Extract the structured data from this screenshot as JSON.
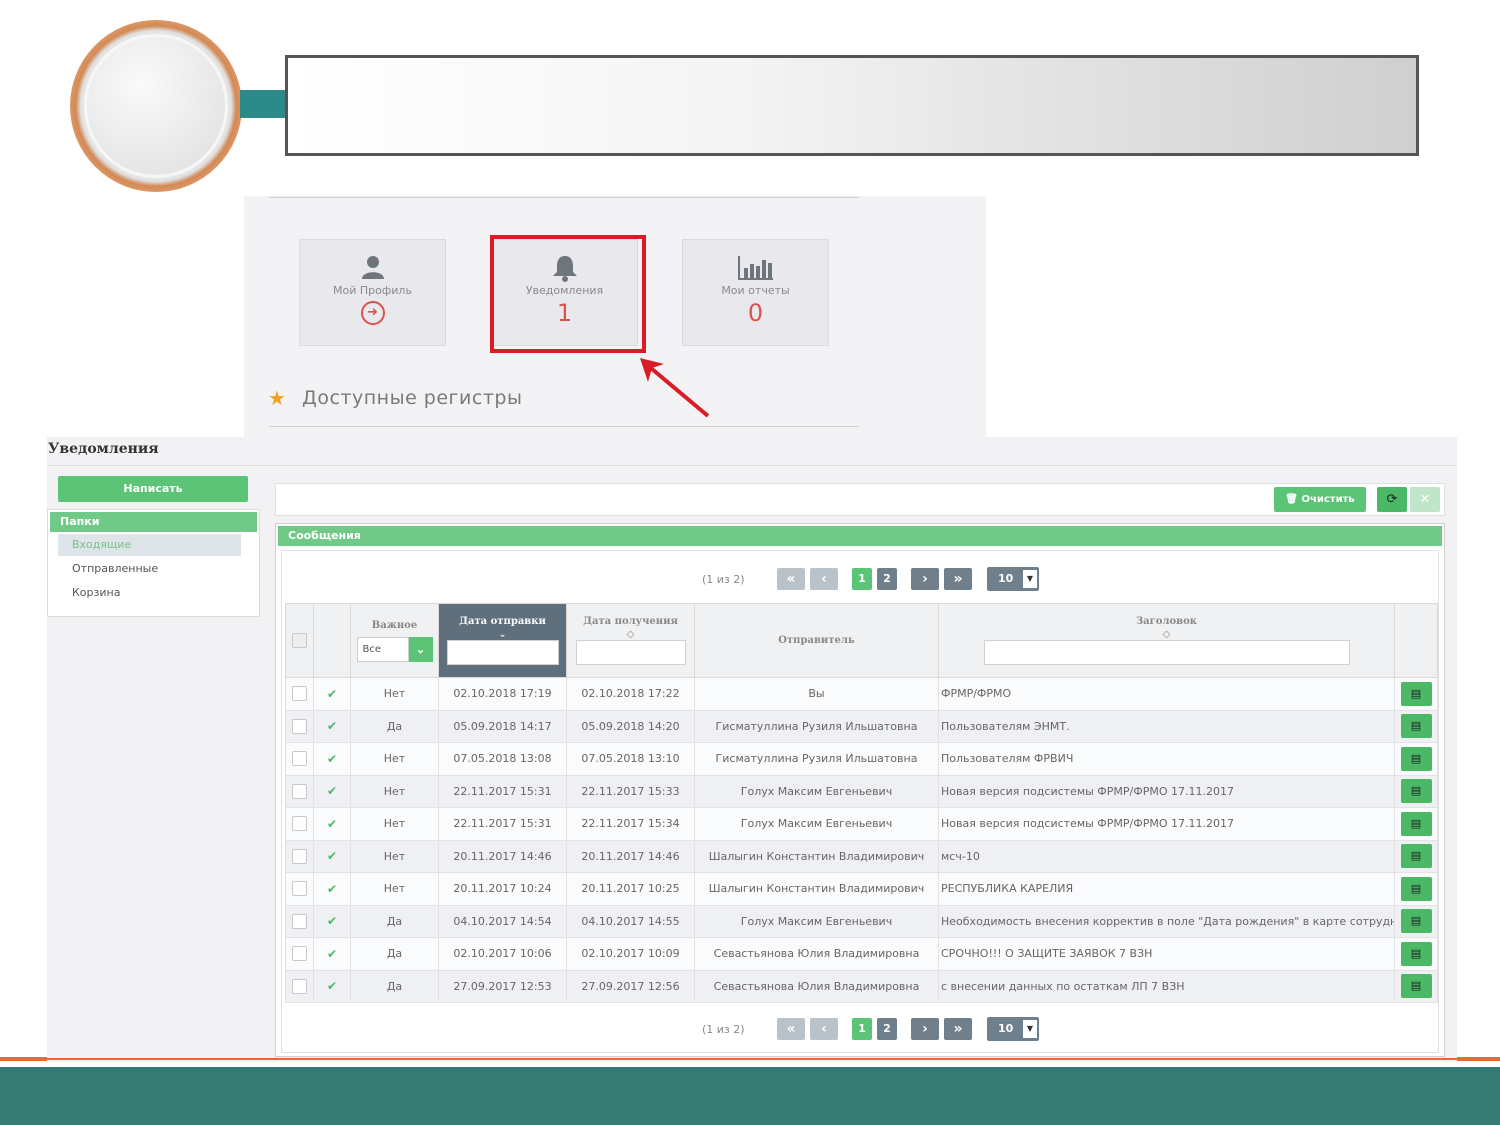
{
  "colors": {
    "accent": "#5cc477",
    "highlight": "#d91c26",
    "footer": "#367a74",
    "header_bar": "#2d8a8a",
    "sorted_header": "#5f6f7c"
  },
  "tiles": [
    {
      "label": "Мой Профиль",
      "icon": "user-icon",
      "value": ""
    },
    {
      "label": "Уведомления",
      "icon": "bell-icon",
      "value": "1"
    },
    {
      "label": "Мои отчеты",
      "icon": "bar-chart-icon",
      "value": "0"
    }
  ],
  "registers_title": "Доступные регистры",
  "app": {
    "page_title": "Уведомления",
    "write_button": "Написать",
    "folders": {
      "header": "Папки",
      "items": [
        "Входящие",
        "Отправленные",
        "Корзина"
      ],
      "active": "Входящие"
    },
    "toolbar": {
      "clear_label": "Очистить",
      "refresh_icon": "refresh-icon",
      "close_icon": "close-icon"
    },
    "messages_header": "Сообщения",
    "pager": {
      "info": "(1 из 2)",
      "pages": [
        "1",
        "2"
      ],
      "current": "1",
      "page_size": "10"
    },
    "columns": {
      "important": "Важное",
      "important_filter": "Все",
      "sent": "Дата отправки",
      "received": "Дата получения",
      "sender": "Отправитель",
      "title": "Заголовок"
    },
    "rows": [
      {
        "important": "Нет",
        "sent": "02.10.2018 17:19",
        "received": "02.10.2018 17:22",
        "sender": "Вы",
        "title": "ФРМР/ФРМО"
      },
      {
        "important": "Да",
        "sent": "05.09.2018 14:17",
        "received": "05.09.2018 14:20",
        "sender": "Гисматуллина Рузиля Ильшатовна",
        "title": "Пользователям ЭНМТ."
      },
      {
        "important": "Нет",
        "sent": "07.05.2018 13:08",
        "received": "07.05.2018 13:10",
        "sender": "Гисматуллина Рузиля Ильшатовна",
        "title": "Пользователям ФРВИЧ"
      },
      {
        "important": "Нет",
        "sent": "22.11.2017 15:31",
        "received": "22.11.2017 15:33",
        "sender": "Голух Максим Евгеньевич",
        "title": "Новая версия подсистемы ФРМР/ФРМО 17.11.2017"
      },
      {
        "important": "Нет",
        "sent": "22.11.2017 15:31",
        "received": "22.11.2017 15:34",
        "sender": "Голух Максим Евгеньевич",
        "title": "Новая версия подсистемы ФРМР/ФРМО 17.11.2017"
      },
      {
        "important": "Нет",
        "sent": "20.11.2017 14:46",
        "received": "20.11.2017 14:46",
        "sender": "Шалыгин Константин Владимирович",
        "title": "мсч-10"
      },
      {
        "important": "Нет",
        "sent": "20.11.2017 10:24",
        "received": "20.11.2017 10:25",
        "sender": "Шалыгин Константин Владимирович",
        "title": "РЕСПУБЛИКА КАРЕЛИЯ"
      },
      {
        "important": "Да",
        "sent": "04.10.2017 14:54",
        "received": "04.10.2017 14:55",
        "sender": "Голух Максим Евгеньевич",
        "title": "Необходимость внесения корректив в поле \"Дата рождения\" в карте сотрудника"
      },
      {
        "important": "Да",
        "sent": "02.10.2017 10:06",
        "received": "02.10.2017 10:09",
        "sender": "Севастьянова Юлия Владимировна",
        "title": "СРОЧНО!!! О ЗАЩИТЕ ЗАЯВОК 7 ВЗН"
      },
      {
        "important": "Да",
        "sent": "27.09.2017 12:53",
        "received": "27.09.2017 12:56",
        "sender": "Севастьянова Юлия Владимировна",
        "title": "с внесении данных по остаткам ЛП 7 ВЗН"
      }
    ]
  }
}
